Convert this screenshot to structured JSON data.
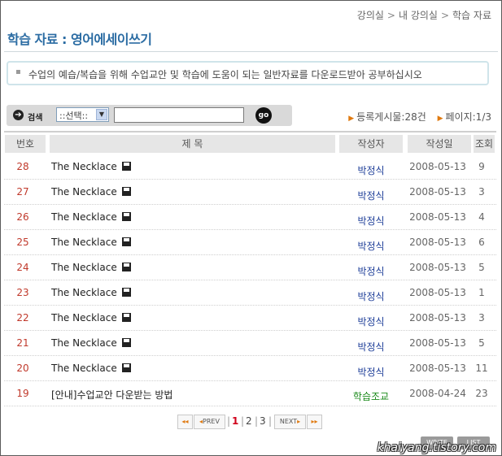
{
  "breadcrumb": [
    "강의실",
    "내 강의실",
    "학습 자료"
  ],
  "breadcrumb_sep": ">",
  "page_title": "학습 자료 : 영어에세이쓰기",
  "notice": "수업의 예습/복습을 위해 수업교안 및 학습에 도움이 되는 일반자료를 다운로드받아 공부하십시오",
  "search": {
    "label": "검색",
    "select_value": "::선택::",
    "input_value": "",
    "go_label": "go"
  },
  "stats": {
    "total": "등록게시물:28건",
    "page": "페이지:1/3"
  },
  "columns": [
    "번호",
    "제 목",
    "작성자",
    "작성일",
    "조회"
  ],
  "rows": [
    {
      "num": "28",
      "subject": "The Necklace",
      "author": "박정식",
      "date": "2008-05-13",
      "views": "9"
    },
    {
      "num": "27",
      "subject": "The Necklace",
      "author": "박정식",
      "date": "2008-05-13",
      "views": "3"
    },
    {
      "num": "26",
      "subject": "The Necklace",
      "author": "박정식",
      "date": "2008-05-13",
      "views": "4"
    },
    {
      "num": "25",
      "subject": "The Necklace",
      "author": "박정식",
      "date": "2008-05-13",
      "views": "6"
    },
    {
      "num": "24",
      "subject": "The Necklace",
      "author": "박정식",
      "date": "2008-05-13",
      "views": "5"
    },
    {
      "num": "23",
      "subject": "The Necklace",
      "author": "박정식",
      "date": "2008-05-13",
      "views": "1"
    },
    {
      "num": "22",
      "subject": "The Necklace",
      "author": "박정식",
      "date": "2008-05-13",
      "views": "3"
    },
    {
      "num": "21",
      "subject": "The Necklace",
      "author": "박정식",
      "date": "2008-05-13",
      "views": "5"
    },
    {
      "num": "20",
      "subject": "The Necklace",
      "author": "박정식",
      "date": "2008-05-13",
      "views": "11"
    },
    {
      "num": "19",
      "subject": "[안내]수업교안 다운받는 방법",
      "author": "학습조교",
      "date": "2008-04-24",
      "views": "23"
    }
  ],
  "pagination": {
    "first": "◂◂",
    "prev": "PREV",
    "pages": [
      "1",
      "2",
      "3"
    ],
    "current": "1",
    "next": "NEXT",
    "last": "▸▸"
  },
  "buttons": {
    "write": "WRITE",
    "list": "LIST"
  },
  "watermark": "khaiyang.tistory.com",
  "colors": {
    "title": "#2b6ca3",
    "number": "#c0392b",
    "author": "#1f3f99",
    "author_staff": "#1b8a1b",
    "current_page": "#d0021b"
  }
}
